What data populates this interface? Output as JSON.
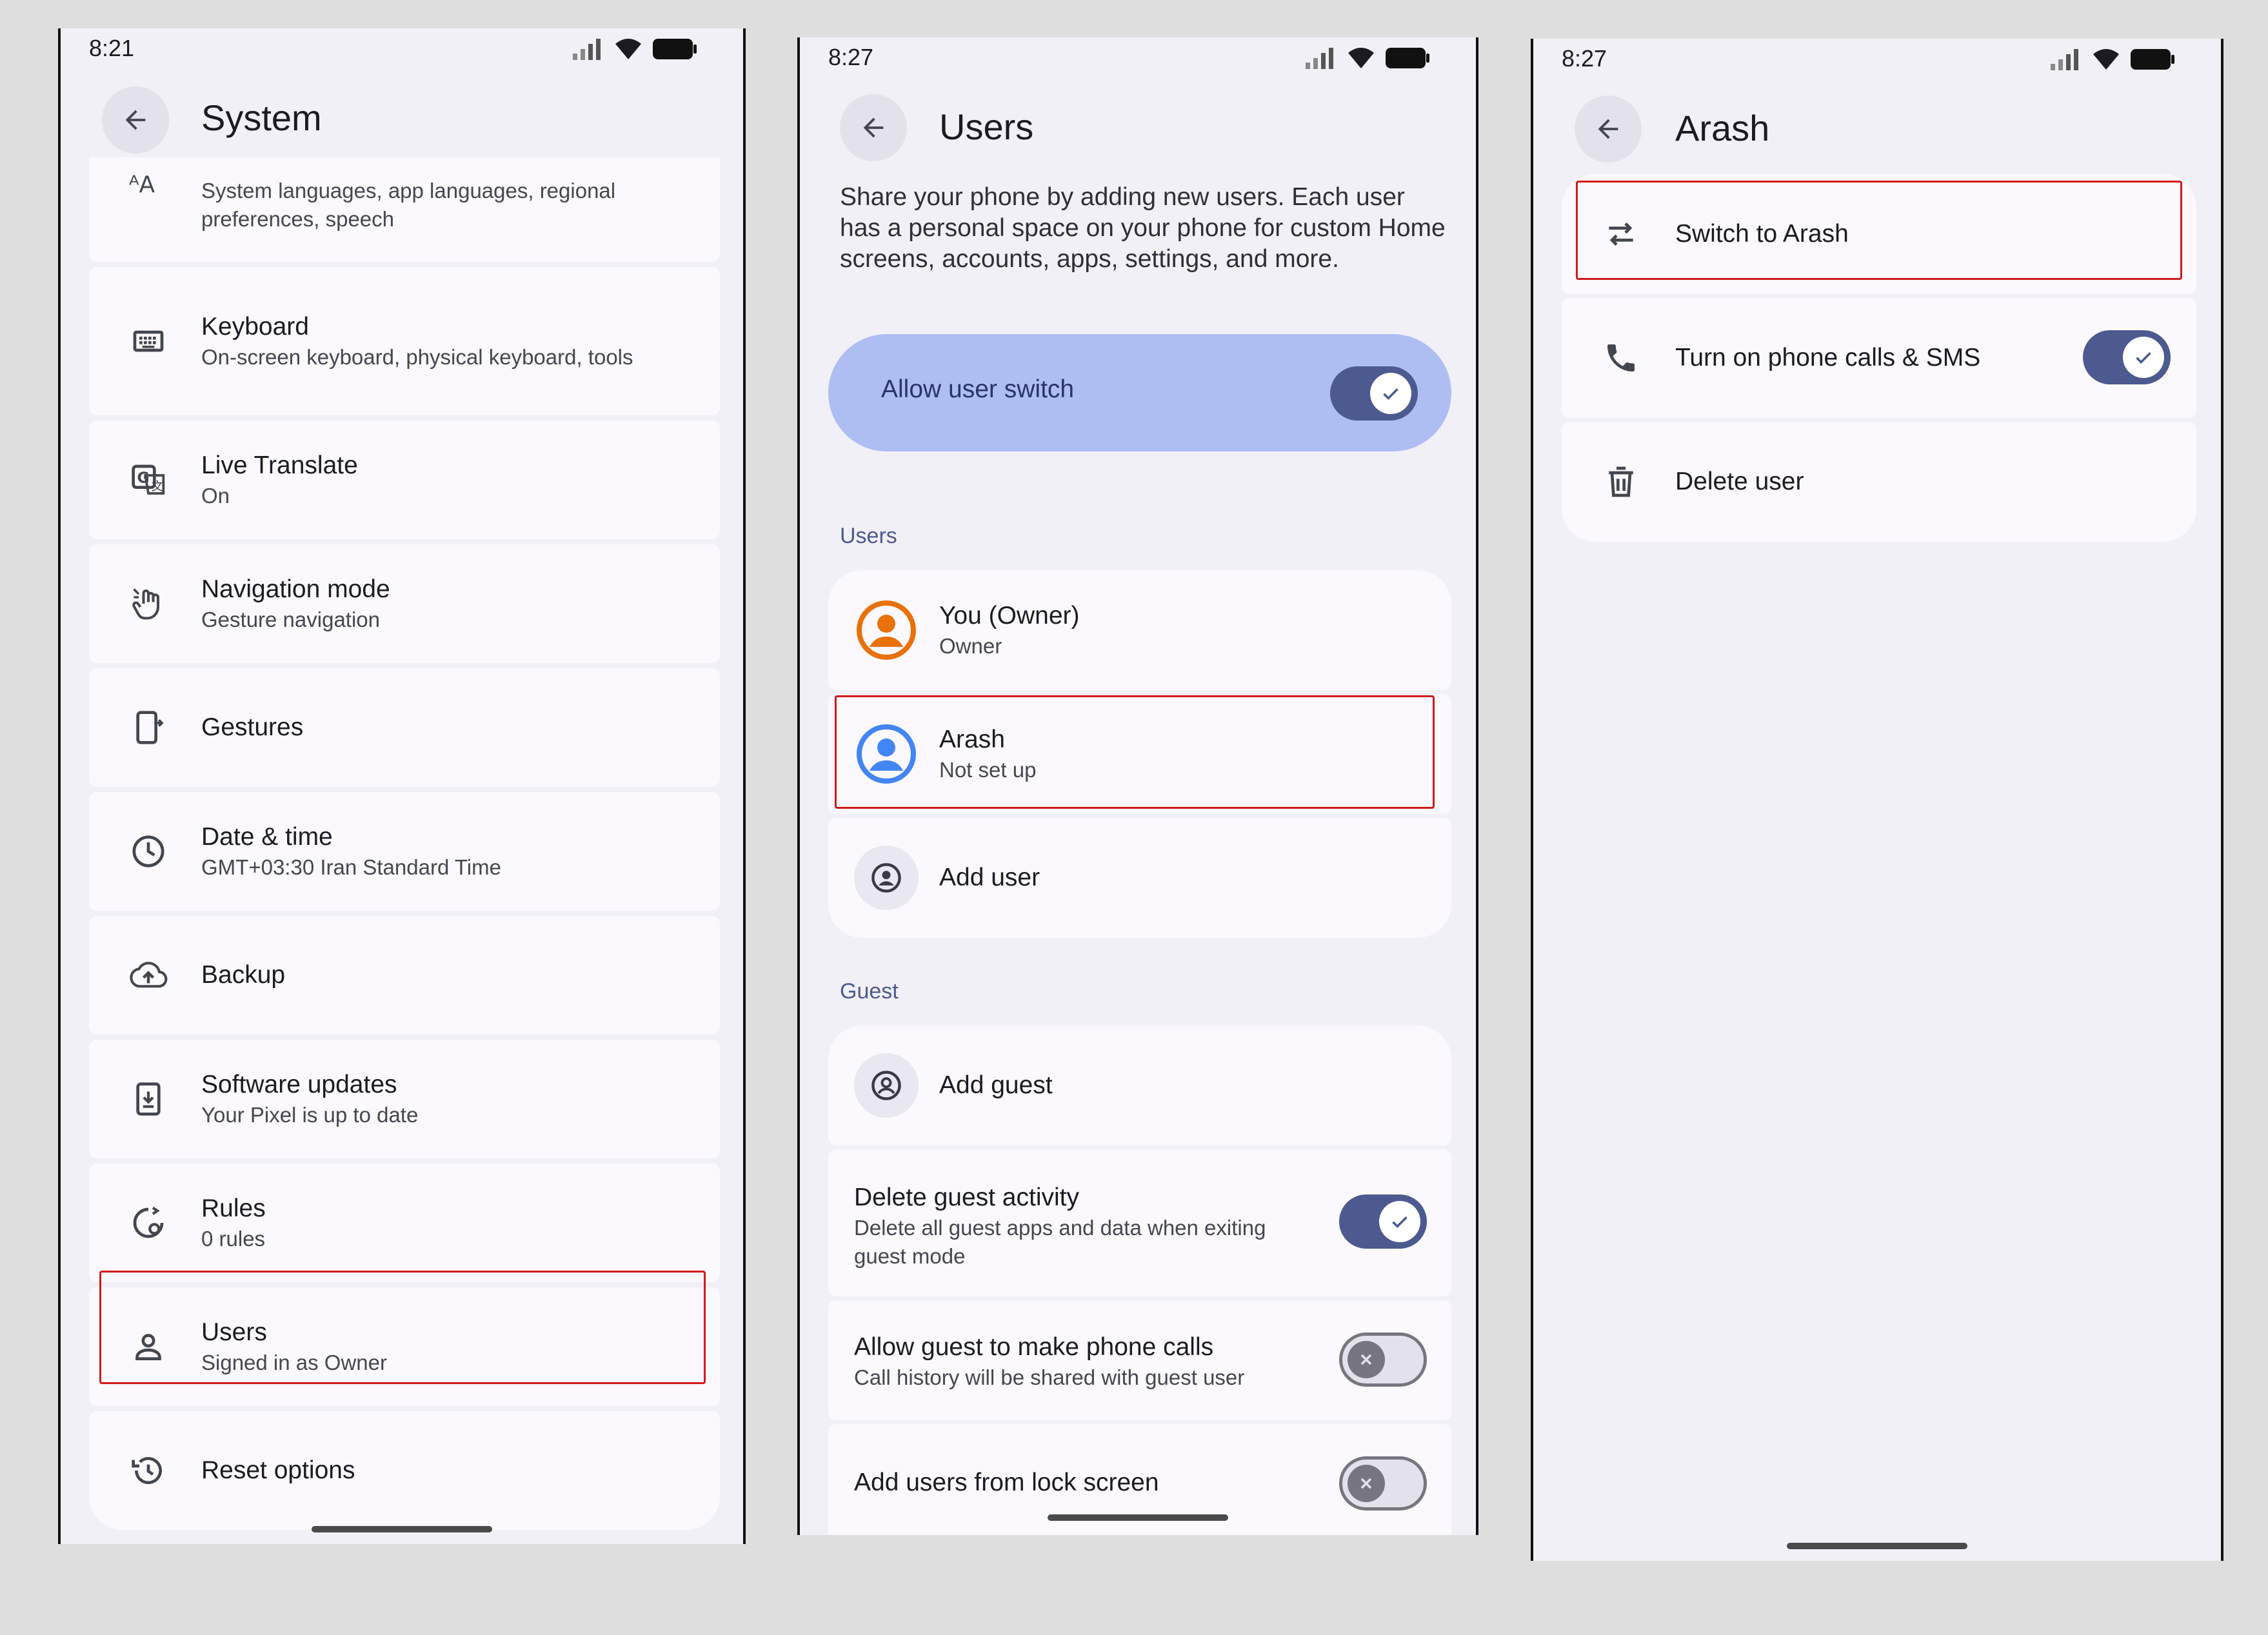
{
  "panel1": {
    "time": "8:21",
    "title": "System",
    "items": [
      {
        "title": "",
        "subtitle": "System languages, app languages, regional preferences, speech",
        "icon": "language-icon"
      },
      {
        "title": "Keyboard",
        "subtitle": "On-screen keyboard, physical keyboard, tools",
        "icon": "keyboard-icon"
      },
      {
        "title": "Live Translate",
        "subtitle": "On",
        "icon": "translate-icon"
      },
      {
        "title": "Navigation mode",
        "subtitle": "Gesture navigation",
        "icon": "gesture-hand-icon"
      },
      {
        "title": "Gestures",
        "subtitle": "",
        "icon": "gestures-phone-icon"
      },
      {
        "title": "Date & time",
        "subtitle": "GMT+03:30 Iran Standard Time",
        "icon": "clock-icon"
      },
      {
        "title": "Backup",
        "subtitle": "",
        "icon": "cloud-upload-icon"
      },
      {
        "title": "Software updates",
        "subtitle": "Your Pixel is up to date",
        "icon": "system-update-icon"
      },
      {
        "title": "Rules",
        "subtitle": "0 rules",
        "icon": "rules-icon"
      },
      {
        "title": "Users",
        "subtitle": "Signed in as Owner",
        "icon": "person-icon"
      },
      {
        "title": "Reset options",
        "subtitle": "",
        "icon": "history-icon"
      }
    ]
  },
  "panel2": {
    "time": "8:27",
    "title": "Users",
    "description": "Share your phone by adding new users. Each user has a personal space on your phone for custom Home screens, accounts, apps, settings, and more.",
    "allow_switch_label": "Allow user switch",
    "section_users": "Users",
    "users": [
      {
        "title": "You (Owner)",
        "subtitle": "Owner",
        "color": "#e8710a"
      },
      {
        "title": "Arash",
        "subtitle": "Not set up",
        "color": "#4285f4"
      }
    ],
    "add_user": "Add user",
    "section_guest": "Guest",
    "add_guest": "Add guest",
    "delete_guest": {
      "title": "Delete guest activity",
      "subtitle": "Delete all guest apps and data when exiting guest mode"
    },
    "guest_calls": {
      "title": "Allow guest to make phone calls",
      "subtitle": "Call history will be shared with guest user"
    },
    "lock_screen": {
      "title": "Add users from lock screen"
    }
  },
  "panel3": {
    "time": "8:27",
    "title": "Arash",
    "switch_label": "Switch to Arash",
    "calls_label": "Turn on phone calls & SMS",
    "delete_label": "Delete user"
  },
  "colors": {
    "accent": "#4c5a8f",
    "highlight": "#d11a1a",
    "switch_card": "#aebef2",
    "background": "#f1f0f7"
  }
}
